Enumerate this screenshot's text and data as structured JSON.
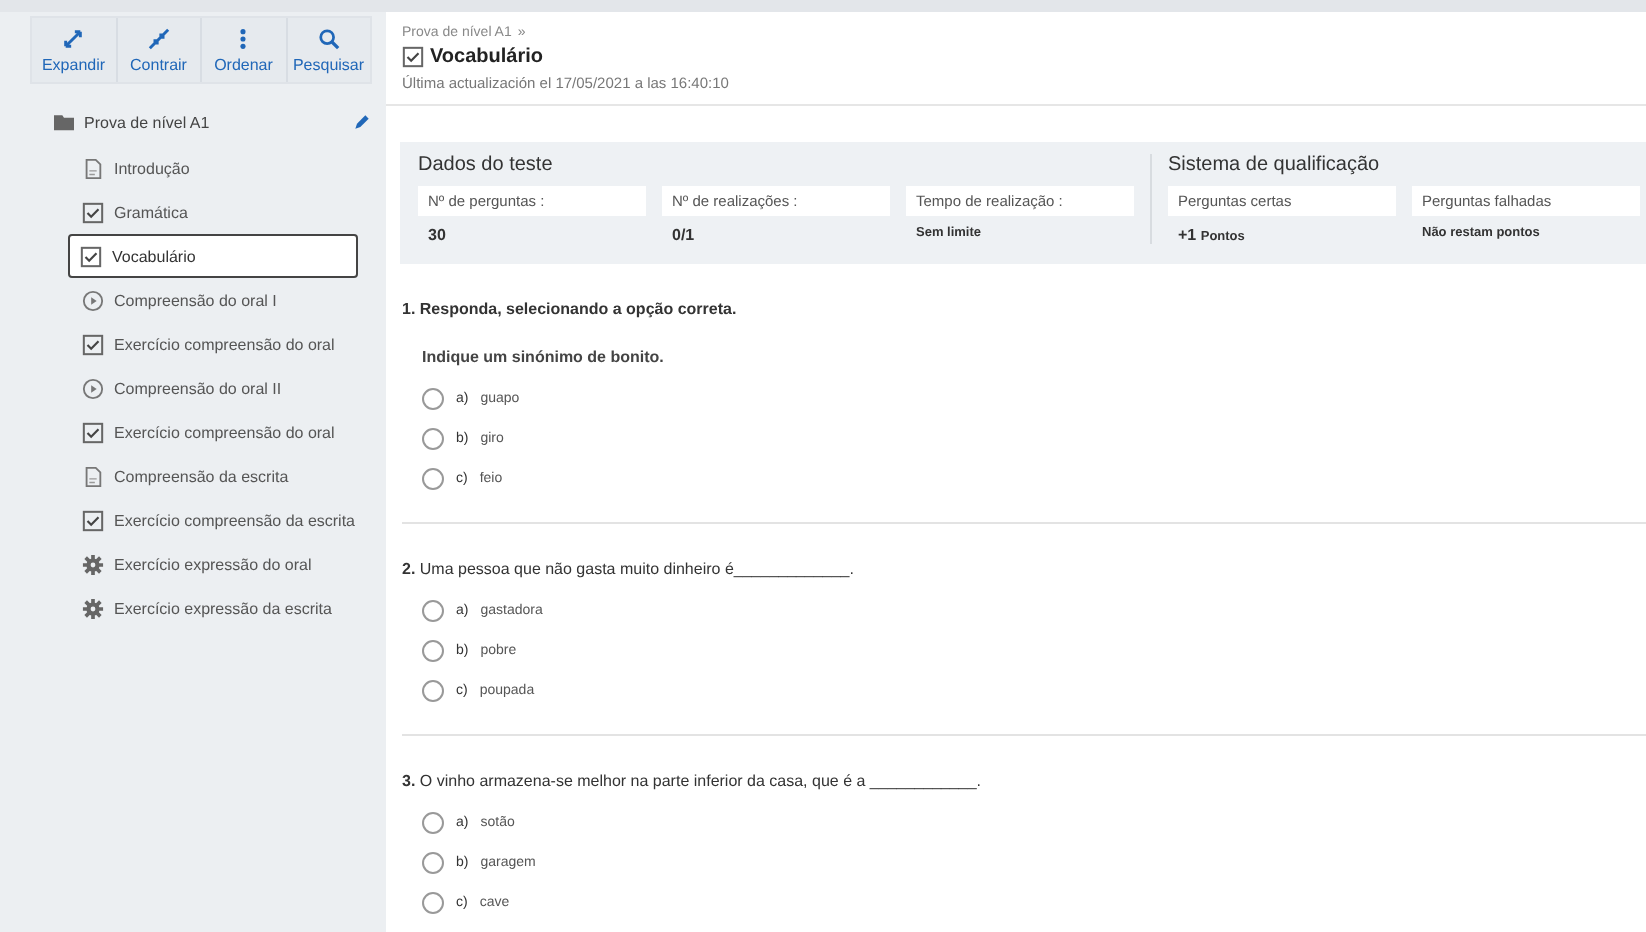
{
  "toolbar": [
    {
      "kind": "expand",
      "label": "Expandir"
    },
    {
      "kind": "collapse",
      "label": "Contrair"
    },
    {
      "kind": "sort",
      "label": "Ordenar"
    },
    {
      "kind": "search",
      "label": "Pesquisar"
    }
  ],
  "tree": {
    "label": "Prova de nível A1",
    "children": [
      {
        "kind": "doc",
        "label": "Introdução",
        "selected": false
      },
      {
        "kind": "check",
        "label": "Gramática",
        "selected": false
      },
      {
        "kind": "check",
        "label": "Vocabulário",
        "selected": true
      },
      {
        "kind": "play",
        "label": "Compreensão do oral I",
        "selected": false
      },
      {
        "kind": "check",
        "label": "Exercício compreensão do oral",
        "selected": false
      },
      {
        "kind": "play",
        "label": "Compreensão do oral II",
        "selected": false
      },
      {
        "kind": "check",
        "label": "Exercício compreensão do oral",
        "selected": false
      },
      {
        "kind": "doc",
        "label": "Compreensão da escrita",
        "selected": false
      },
      {
        "kind": "check",
        "label": "Exercício compreensão da escrita",
        "selected": false
      },
      {
        "kind": "gear",
        "label": "Exercício expressão do oral",
        "selected": false
      },
      {
        "kind": "gear",
        "label": "Exercício expressão da escrita",
        "selected": false
      }
    ]
  },
  "header": {
    "breadcrumb": "Prova de nível A1",
    "breadcrumb_sep": "»",
    "title": "Vocabulário",
    "updated": "Última actualización el 17/05/2021 a las 16:40:10"
  },
  "stats": [
    {
      "title": "Dados do teste",
      "cards": [
        {
          "label": "Nº de perguntas :",
          "value": "30"
        },
        {
          "label": "Nº de realizações :",
          "value": "0/1"
        },
        {
          "label": "Tempo de realização :",
          "value": "Sem limite",
          "small": true
        }
      ]
    },
    {
      "title": "Sistema de qualificação",
      "cards": [
        {
          "label": "Perguntas certas",
          "value": "+1",
          "unit": "Pontos"
        },
        {
          "label": "Perguntas falhadas",
          "value": "Não restam pontos",
          "small": true
        }
      ]
    }
  ],
  "questions": [
    {
      "number": "1.",
      "text": "Responda, selecionando a opção correta.",
      "prompt": "Indique um sinónimo de bonito.",
      "options": [
        {
          "letter": "a)",
          "text": "guapo",
          "selected": false
        },
        {
          "letter": "b)",
          "text": "giro",
          "selected": false
        },
        {
          "letter": "c)",
          "text": "feio",
          "selected": false
        }
      ]
    },
    {
      "number": "2.",
      "text": "Uma pessoa que não gasta muito dinheiro é_____________.",
      "options": [
        {
          "letter": "a)",
          "text": "gastadora",
          "selected": false
        },
        {
          "letter": "b)",
          "text": "pobre",
          "selected": false
        },
        {
          "letter": "c)",
          "text": "poupada",
          "selected": false
        }
      ]
    },
    {
      "number": "3.",
      "text": "O vinho armazena-se melhor na parte inferior da casa, que é a ____________.",
      "options": [
        {
          "letter": "a)",
          "text": "sotão",
          "selected": false
        },
        {
          "letter": "b)",
          "text": "garagem",
          "selected": false
        },
        {
          "letter": "c)",
          "text": "cave",
          "selected": false
        }
      ]
    }
  ]
}
